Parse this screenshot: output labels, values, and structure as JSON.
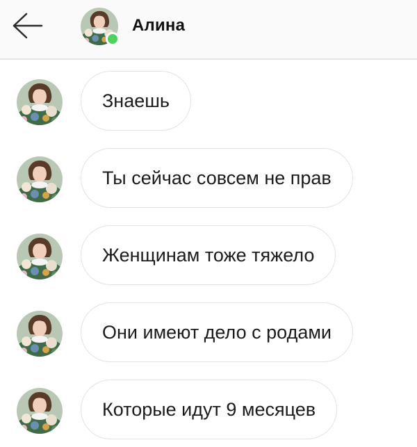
{
  "header": {
    "back_icon": "arrow-left-icon",
    "contact_name": "Алина",
    "online_color": "#4cd35a"
  },
  "messages": [
    {
      "text": "Знаешь"
    },
    {
      "text": "Ты сейчас совсем не прав"
    },
    {
      "text": "Женщинам тоже тяжело"
    },
    {
      "text": "Они имеют дело с родами"
    },
    {
      "text": "Которые идут 9 месяцев"
    }
  ]
}
